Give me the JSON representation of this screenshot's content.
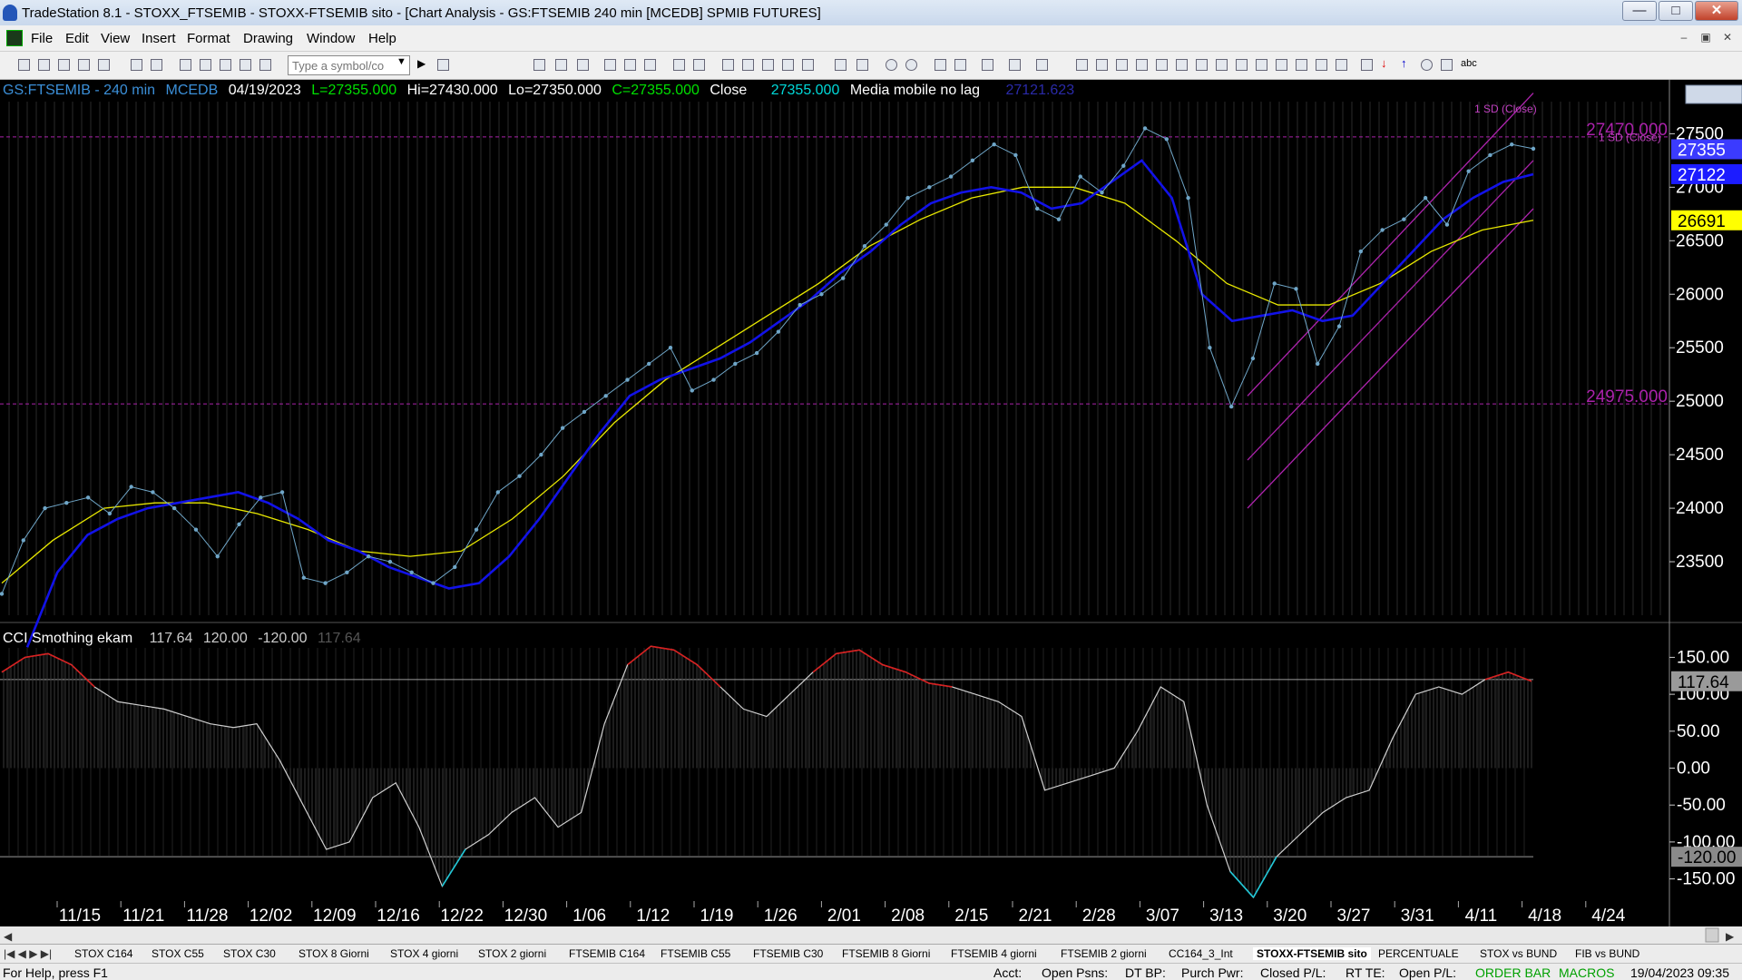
{
  "window": {
    "title": "TradeStation 8.1 - STOXX_FTSEMIB - STOXX-FTSEMIB sito - [Chart Analysis - GS:FTSEMIB  240 min  [MCEDB] SPMIB FUTURES]",
    "minimize": "—",
    "maximize": "□",
    "close": "✕"
  },
  "menu": {
    "items": [
      "File",
      "Edit",
      "View",
      "Insert",
      "Format",
      "Drawing",
      "Window",
      "Help"
    ],
    "mdi": [
      "–",
      "▣",
      "✕"
    ]
  },
  "toolbar": {
    "symbol_placeholder": "Type a symbol/co",
    "text_tool": "abc"
  },
  "chart_header": {
    "symbol": "GS:FTSEMIB - 240 min",
    "provider": "MCEDB",
    "date": "04/19/2023",
    "low": "L=27355.000",
    "high": "Hi=27430.000",
    "lo": "Lo=27350.000",
    "close": "C=27355.000",
    "close_label": "Close",
    "close_value": "27355.000",
    "indicator": "Media mobile no lag",
    "indicator_value": "27121.623",
    "colors": {
      "symbol": "#3b8fd8",
      "high": "#00e000",
      "value": "#00d8d8",
      "indicator": "#2a2aa8"
    }
  },
  "cci_header": {
    "name": "CCI Smothing ekam",
    "v1": "117.64",
    "v2": "120.00",
    "v3": "-120.00",
    "v4": "117.64"
  },
  "chart_data": [
    {
      "type": "line",
      "name": "price",
      "x": [
        "11/15",
        "11/21",
        "11/28",
        "12/02",
        "12/09",
        "12/16",
        "12/22",
        "12/30",
        "1/06",
        "1/12",
        "1/19",
        "1/26",
        "2/01",
        "2/08",
        "2/15",
        "2/21",
        "2/28",
        "3/07",
        "3/13",
        "3/20",
        "3/27",
        "3/31",
        "4/11",
        "4/18",
        "4/24"
      ],
      "ylim": [
        23000,
        27800
      ],
      "yticks": [
        23500,
        24000,
        24500,
        25000,
        25500,
        26000,
        26500,
        27000,
        27500
      ],
      "ytick_labels": [
        "23500",
        "24000",
        "24500",
        "25000",
        "25500",
        "26000",
        "26500",
        "27000",
        "27500"
      ],
      "series": [
        {
          "name": "close",
          "color": "#00d8e8",
          "values": [
            23200,
            23700,
            24000,
            24050,
            24100,
            23950,
            24200,
            24150,
            24000,
            23800,
            23550,
            23850,
            24100,
            24150,
            23350,
            23300,
            23400,
            23550,
            23500,
            23400,
            23300,
            23450,
            23800,
            24150,
            24300,
            24500,
            24750,
            24900,
            25050,
            25200,
            25350,
            25500,
            25100,
            25200,
            25350,
            25450,
            25650,
            25900,
            26000,
            26150,
            26450,
            26650,
            26900,
            27000,
            27100,
            27250,
            27400,
            27300,
            26800,
            26700,
            27100,
            26950,
            27200,
            27550,
            27450,
            26900,
            25500,
            24950,
            25400,
            26100,
            26050,
            25350,
            25700,
            26400,
            26600,
            26700,
            26900,
            26650,
            27150,
            27300,
            27400,
            27360
          ]
        },
        {
          "name": "moving average",
          "color": "#1212e8",
          "values": [
            22700,
            23400,
            23750,
            23900,
            24000,
            24050,
            24100,
            24150,
            24050,
            23900,
            23700,
            23600,
            23450,
            23350,
            23250,
            23300,
            23550,
            23900,
            24300,
            24700,
            25050,
            25200,
            25300,
            25400,
            25550,
            25750,
            25950,
            26200,
            26400,
            26650,
            26850,
            26950,
            27000,
            26950,
            26800,
            26850,
            27050,
            27250,
            26900,
            26000,
            25750,
            25800,
            25850,
            25750,
            25800,
            26100,
            26400,
            26700,
            26900,
            27050,
            27122
          ]
        },
        {
          "name": "average",
          "color": "#e8e800",
          "values": [
            23300,
            23700,
            24000,
            24050,
            24050,
            23950,
            23800,
            23600,
            23550,
            23600,
            23900,
            24300,
            24800,
            25200,
            25500,
            25800,
            26100,
            26450,
            26700,
            26900,
            27000,
            27000,
            26850,
            26500,
            26100,
            25900,
            25900,
            26100,
            26400,
            26600,
            26691
          ]
        }
      ],
      "levels": [
        {
          "value": 27470.0,
          "label": "27470.000",
          "color": "#aa22aa"
        },
        {
          "value": 24975.0,
          "label": "24975.000",
          "color": "#aa22aa"
        }
      ],
      "channel_labels": [
        "1 SD (Close)",
        "1 SD (Close)"
      ],
      "axis_badges": [
        {
          "value": 27355,
          "label": "27355",
          "bg": "#3b3bff",
          "fg": "#ffffff"
        },
        {
          "value": 27122,
          "label": "27122",
          "bg": "#1c1cff",
          "fg": "#ffffff"
        },
        {
          "value": 26691,
          "label": "26691",
          "bg": "#ffff00",
          "fg": "#000000"
        }
      ]
    },
    {
      "type": "line",
      "name": "CCI",
      "ylim": [
        -180,
        180
      ],
      "yticks": [
        150,
        100,
        50,
        0,
        -50,
        -100,
        -150
      ],
      "ytick_labels": [
        "150.00",
        "100.00",
        "50.00",
        "0.00",
        "-50.00",
        "-100.00",
        "-150.00"
      ],
      "thresholds": [
        120,
        -120
      ],
      "series": [
        {
          "name": "CCI",
          "values": [
            130,
            150,
            155,
            140,
            110,
            90,
            85,
            80,
            70,
            60,
            55,
            60,
            10,
            -50,
            -110,
            -100,
            -40,
            -20,
            -80,
            -160,
            -110,
            -90,
            -60,
            -40,
            -80,
            -60,
            60,
            140,
            165,
            160,
            140,
            110,
            80,
            70,
            100,
            130,
            155,
            160,
            140,
            130,
            115,
            110,
            100,
            90,
            70,
            -30,
            -20,
            -10,
            0,
            50,
            110,
            90,
            -50,
            -140,
            -175,
            -120,
            -90,
            -60,
            -40,
            -30,
            40,
            100,
            110,
            100,
            120,
            130,
            117.64
          ]
        }
      ],
      "current_badge": "117.64",
      "threshold_badge": "-120.00"
    }
  ],
  "tabs": [
    "STOX C164",
    "STOX C55",
    "STOX  C30",
    "STOX  8 Giorni",
    "STOX 4 giorni",
    "STOX  2 giorni",
    "FTSEMIB C164",
    "FTSEMIB C55",
    "FTSEMIB C30",
    "FTSEMIB  8 Giorni",
    "FTSEMIB  4 giorni",
    "FTSEMIB  2 giorni",
    "CC164_3_Int",
    "STOXX-FTSEMIB sito",
    "PERCENTUALE",
    "STOX vs BUND",
    "FIB vs BUND"
  ],
  "active_tab": "STOXX-FTSEMIB sito",
  "status": {
    "help": "For Help, press F1",
    "acct": "Acct:",
    "open_psns": "Open Psns:",
    "dt_bp": "DT BP:",
    "purch_pwr": "Purch Pwr:",
    "closed_pl": "Closed P/L:",
    "rt_te": "RT TE:",
    "open_pl": "Open P/L:",
    "order_bar": "ORDER BAR",
    "macros": "MACROS",
    "datetime": "19/04/2023 09:35"
  }
}
